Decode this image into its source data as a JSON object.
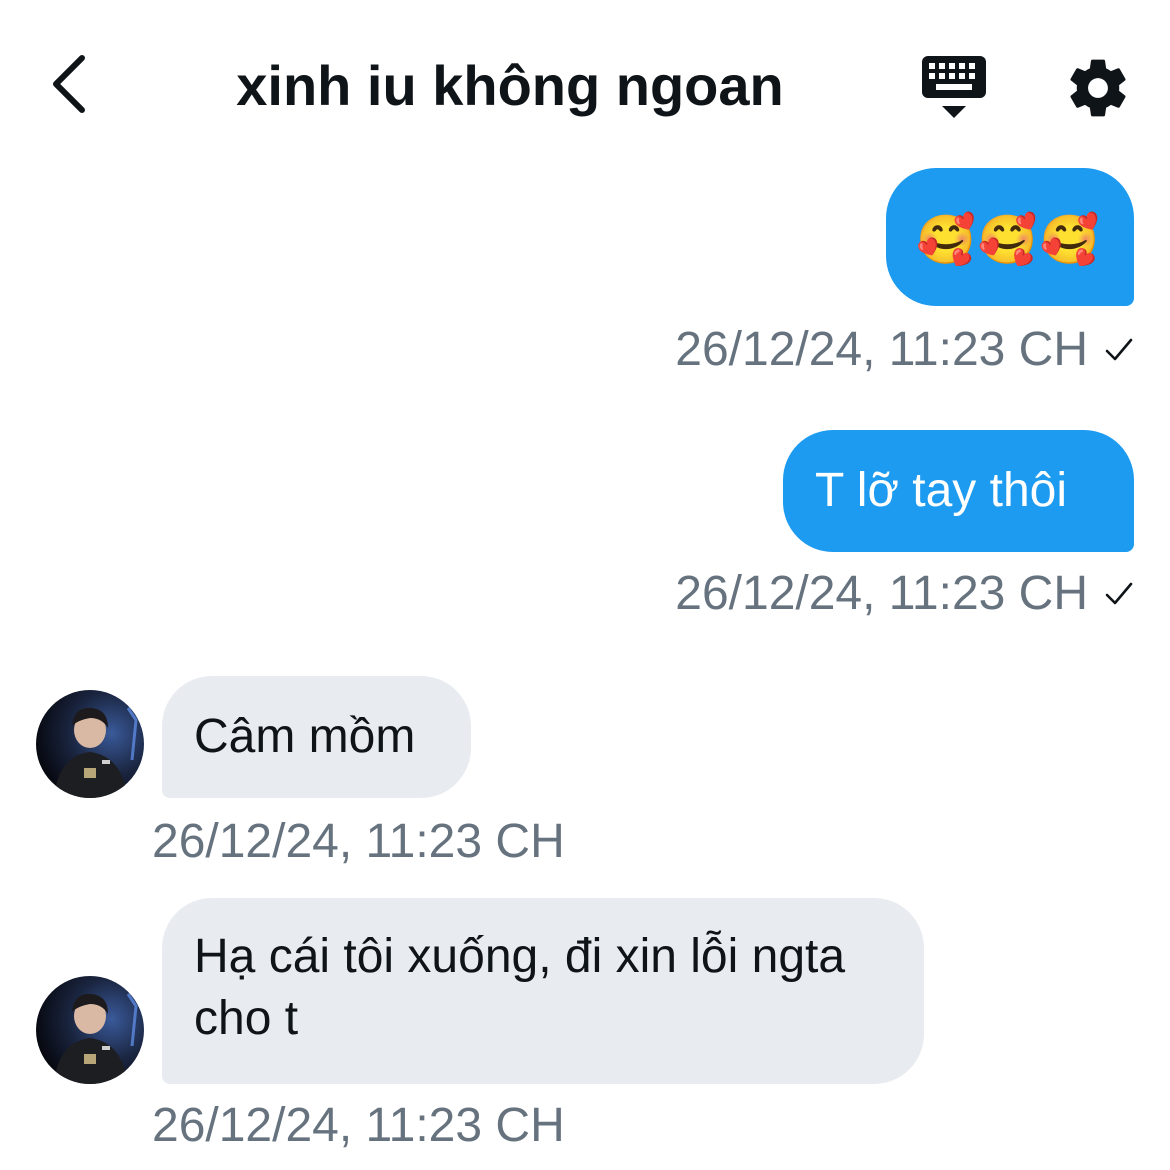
{
  "header": {
    "title": "xinh iu không ngoan",
    "back_icon": "chevron-left-icon",
    "keyboard_icon": "keyboard-icon",
    "settings_icon": "gear-icon"
  },
  "messages": [
    {
      "direction": "outgoing",
      "text": "🥰🥰🥰",
      "timestamp": "26/12/24, 11:23 CH",
      "status_icon": "check-icon"
    },
    {
      "direction": "outgoing",
      "text": "T lỡ tay thôi",
      "timestamp": "26/12/24, 11:23 CH",
      "status_icon": "check-icon"
    },
    {
      "direction": "incoming",
      "text": "Câm mồm",
      "timestamp": "26/12/24, 11:23 CH"
    },
    {
      "direction": "incoming",
      "text": "Hạ cái tôi xuống, đi xin lỗi ngta cho t",
      "timestamp": "26/12/24, 11:23 CH"
    }
  ],
  "colors": {
    "outgoing_bubble": "#1d9bf0",
    "incoming_bubble": "#e8ecf0",
    "timestamp_text": "#66737f",
    "title_text": "#0f1419"
  }
}
